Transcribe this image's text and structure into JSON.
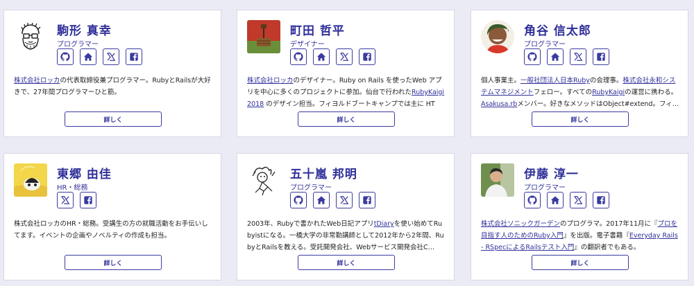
{
  "colors": {
    "accent": "#2f2f9a",
    "background": "#ebebf5",
    "card": "#ffffff"
  },
  "cards": [
    {
      "name": "駒形 真幸",
      "role": "プログラマー",
      "socials": [
        "github-icon",
        "home-icon",
        "x-icon",
        "facebook-icon"
      ],
      "bio": [
        {
          "t": "株式会社ロッカ",
          "link": true
        },
        {
          "t": "の代表取締役兼プログラマー。RubyとRailsが大好きで、27年間プログラマーひと筋。",
          "link": false
        }
      ],
      "more_label": "詳しく"
    },
    {
      "name": "町田 哲平",
      "role": "デザイナー",
      "socials": [
        "github-icon",
        "home-icon",
        "x-icon",
        "facebook-icon"
      ],
      "bio": [
        {
          "t": "株式会社ロッカ",
          "link": true
        },
        {
          "t": "のデザイナー。Ruby on Rails を使ったWeb アプリを中心に多くのプロジェクトに参加。仙台で行われた",
          "link": false
        },
        {
          "t": "RubyKaigi 2018",
          "link": true
        },
        {
          "t": " のデザイン担当。フィヨルドブートキャンプでは主に HTM…",
          "link": false
        }
      ],
      "more_label": "詳しく"
    },
    {
      "name": "角谷 信太郎",
      "role": "プログラマー",
      "socials": [
        "github-icon",
        "home-icon",
        "x-icon",
        "facebook-icon"
      ],
      "bio": [
        {
          "t": "個人事業主。",
          "link": false
        },
        {
          "t": "一般社団法人日本Ruby",
          "link": true
        },
        {
          "t": "の会理事。",
          "link": false
        },
        {
          "t": "株式会社永和システムマネジメント",
          "link": true
        },
        {
          "t": "フェロー。すべての",
          "link": false
        },
        {
          "t": "RubyKaigi",
          "link": true
        },
        {
          "t": "の運営に携わる。",
          "link": false
        },
        {
          "t": "Asakusa.rb",
          "link": true
        },
        {
          "t": "メンバー。好きなメソッドはObject#extend。フィ…",
          "link": false
        }
      ],
      "more_label": "詳しく"
    },
    {
      "name": "東郷 由佳",
      "role": "HR・総務",
      "socials": [
        "x-icon",
        "facebook-icon"
      ],
      "bio": [
        {
          "t": "株式会社ロッカのHR・総務。受講生の方の就職活動をお手伝いしてます。イベントの企画やノベルティの作成も担当。",
          "link": false
        }
      ],
      "more_label": "詳しく"
    },
    {
      "name": "五十嵐 邦明",
      "role": "プログラマー",
      "socials": [
        "github-icon",
        "home-icon",
        "x-icon",
        "facebook-icon"
      ],
      "bio": [
        {
          "t": "2003年、Rubyで書かれたWeb日記アプリ",
          "link": false
        },
        {
          "t": "tDiary",
          "link": true
        },
        {
          "t": "を使い始めてRubyistになる。一橋大学の非常勤講師として2012年から2年間、RubyとRailsを教える。受託開発会社、Webサービス開発会社C…",
          "link": false
        }
      ],
      "more_label": "詳しく"
    },
    {
      "name": "伊藤 淳一",
      "role": "プログラマー",
      "socials": [
        "github-icon",
        "home-icon",
        "x-icon",
        "facebook-icon"
      ],
      "bio": [
        {
          "t": "株式会社ソニックガーデン",
          "link": true
        },
        {
          "t": "のプログラマ。2017年11月に『",
          "link": false
        },
        {
          "t": "プロを目指す人のためのRuby入門",
          "link": true
        },
        {
          "t": "』を出版。電子書籍『",
          "link": false
        },
        {
          "t": "Everyday Rails - RSpecによるRailsテスト入門",
          "link": true
        },
        {
          "t": "』の翻訳者でもある。",
          "link": false
        }
      ],
      "more_label": "詳しく"
    }
  ]
}
